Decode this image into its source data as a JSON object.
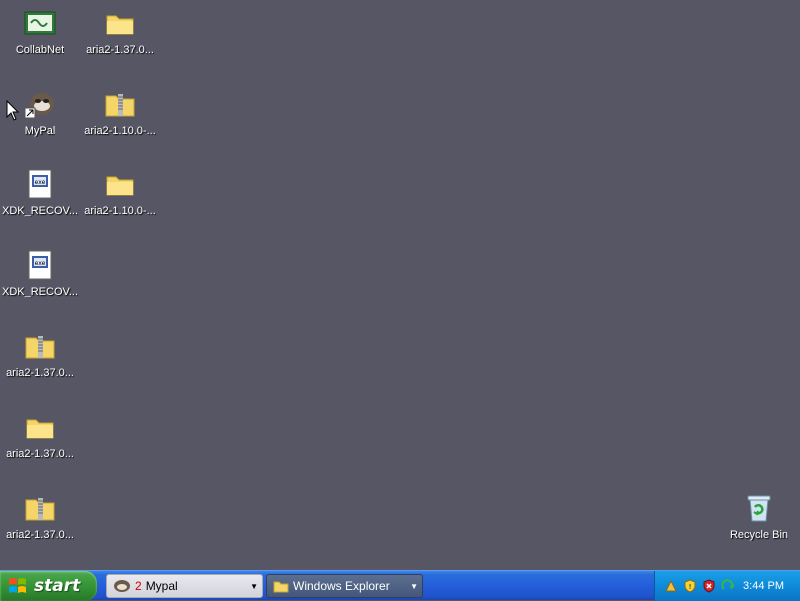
{
  "desktop_icons": [
    {
      "label": "CollabNet",
      "icon": "collabnet-icon"
    },
    {
      "label": "aria2-1.37.0...",
      "icon": "folder-icon"
    },
    {
      "label": "MyPal",
      "icon": "mypal-shortcut-icon"
    },
    {
      "label": "aria2-1.10.0-...",
      "icon": "zip-folder-icon"
    },
    {
      "label": "XDK_RECOV...",
      "icon": "document-icon"
    },
    {
      "label": "aria2-1.10.0-...",
      "icon": "folder-icon"
    },
    {
      "label": "XDK_RECOV...",
      "icon": "document-icon"
    },
    {
      "label": "aria2-1.37.0...",
      "icon": "zip-folder-icon"
    },
    {
      "label": "aria2-1.37.0...",
      "icon": "folder-icon"
    },
    {
      "label": "aria2-1.37.0...",
      "icon": "zip-folder-icon"
    },
    {
      "label": "Recycle Bin",
      "icon": "recycle-bin-icon"
    }
  ],
  "taskbar": {
    "start_label": "start",
    "tasks": [
      {
        "count": "2",
        "label": "Mypal",
        "icon": "mypal-icon"
      },
      {
        "label": "Windows Explorer",
        "icon": "folder-icon"
      }
    ],
    "tray_icons": [
      "network-icon",
      "security-shield-icon",
      "security-alert-icon",
      "recycle-tray-icon"
    ],
    "clock": "3:44 PM"
  }
}
